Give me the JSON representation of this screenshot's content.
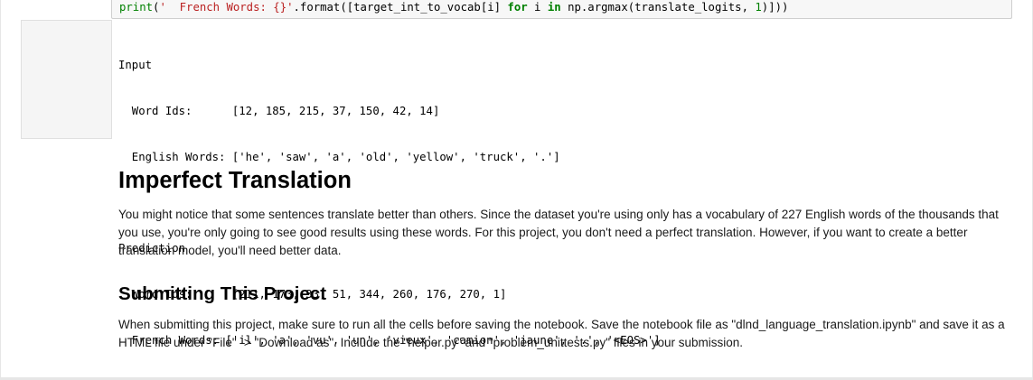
{
  "code_cell": {
    "tokens": [
      {
        "cls": "tk-builtin",
        "text": "print"
      },
      {
        "cls": "tk-plain",
        "text": "("
      },
      {
        "cls": "tk-str",
        "text": "'  French Words: {}'"
      },
      {
        "cls": "tk-plain",
        "text": ".format(["
      },
      {
        "cls": "tk-plain",
        "text": "target_int_to_vocab[i] "
      },
      {
        "cls": "tk-kw",
        "text": "for"
      },
      {
        "cls": "tk-plain",
        "text": " i "
      },
      {
        "cls": "tk-kw",
        "text": "in"
      },
      {
        "cls": "tk-plain",
        "text": " np.argmax(translate_logits, "
      },
      {
        "cls": "tk-num",
        "text": "1"
      },
      {
        "cls": "tk-plain",
        "text": ")]))"
      }
    ]
  },
  "output": {
    "input_header": "Input",
    "input_word_ids": "  Word Ids:      [12, 185, 215, 37, 150, 42, 14]",
    "input_english_words": "  English Words: ['he', 'saw', 'a', 'old', 'yellow', 'truck', '.']",
    "prediction_header": "Prediction",
    "prediction_word_ids": "  Word Ids:      [211, 173, 33, 51, 344, 260, 176, 270, 1]",
    "prediction_french_words": "  French Words: ['il', 'a', 'vu', 'un', 'vieux', 'camion', 'jaune', '.', '<EOS>']"
  },
  "markdown": {
    "heading1": "Imperfect Translation",
    "paragraph1": "You might notice that some sentences translate better than others. Since the dataset you're using only has a vocabulary of 227 English words of the thousands that you use, you're only going to see good results using these words. For this project, you don't need a perfect translation. However, if you want to create a better translation model, you'll need better data.",
    "heading2": "Submitting This Project",
    "paragraph2": "When submitting this project, make sure to run all the cells before saving the notebook. Save the notebook file as \"dlnd_language_translation.ipynb\" and save it as a HTML file under \"File\" -> \"Download as\". Include the \"helper.py\" and \"problem_unittests.py\" files in your submission."
  }
}
